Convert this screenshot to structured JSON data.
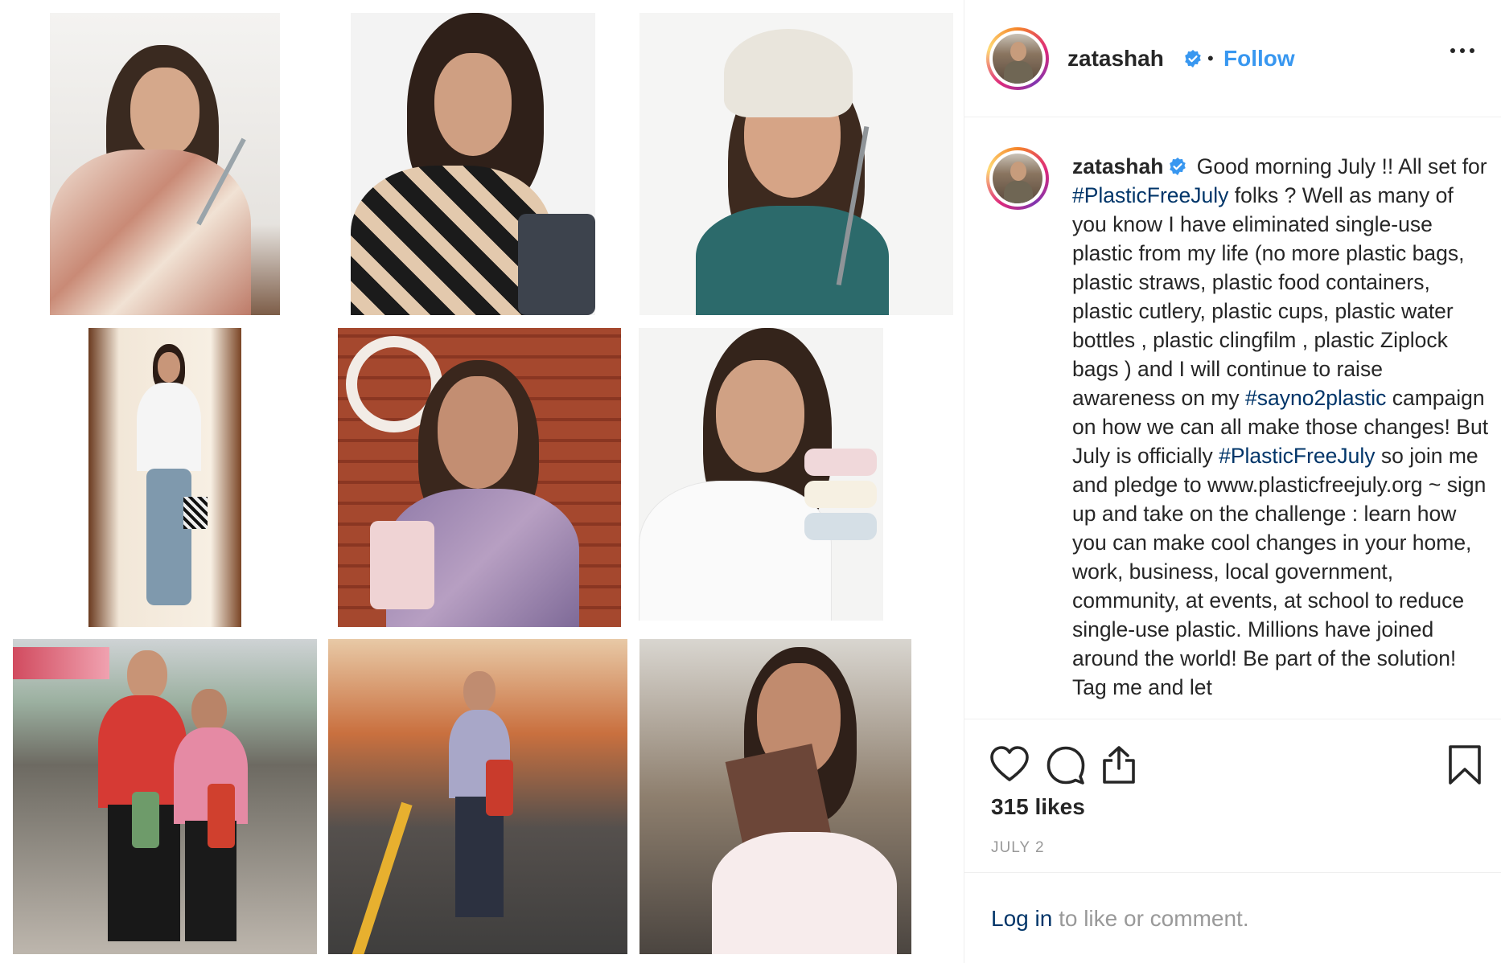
{
  "post": {
    "username": "zatashah",
    "dot": "•",
    "follow_label": "Follow"
  },
  "caption": {
    "username": "zatashah",
    "t1": " Good morning July !! All set for ",
    "h1": "#PlasticFreeJuly",
    "t2": " folks ? Well as many of you know I have eliminated single-use plastic from my life (no more plastic bags, plastic straws, plastic food containers, plastic cutlery, plastic cups, plastic water bottles , plastic clingfilm , plastic Ziplock bags ) and I will continue to raise awareness on my ",
    "h2": "#sayno2plastic",
    "t3": " campaign on how we can all make those changes! But July is officially ",
    "h3": "#PlasticFreeJuly",
    "t4": " so join me and pledge to www.plasticfreejuly.org ~ sign up and take on the challenge : learn how you can make cool changes in your home, work, business, local government, community, at events, at school to reduce single-use plastic. Millions have joined around the world! Be part of the solution! Tag me and let"
  },
  "engagement": {
    "likes": "315 likes",
    "date": "JULY 2"
  },
  "login": {
    "link": "Log in",
    "rest": " to like or comment."
  },
  "icons": {
    "like": "heart-icon",
    "comment": "comment-bubble-icon",
    "share": "share-icon",
    "save": "bookmark-icon",
    "more": "ellipsis-icon",
    "verified": "verified-badge-icon"
  },
  "colors": {
    "follow": "#3897f0",
    "hashtag": "#003569",
    "verified": "#3897f0",
    "muted": "#999999",
    "text": "#262626"
  }
}
